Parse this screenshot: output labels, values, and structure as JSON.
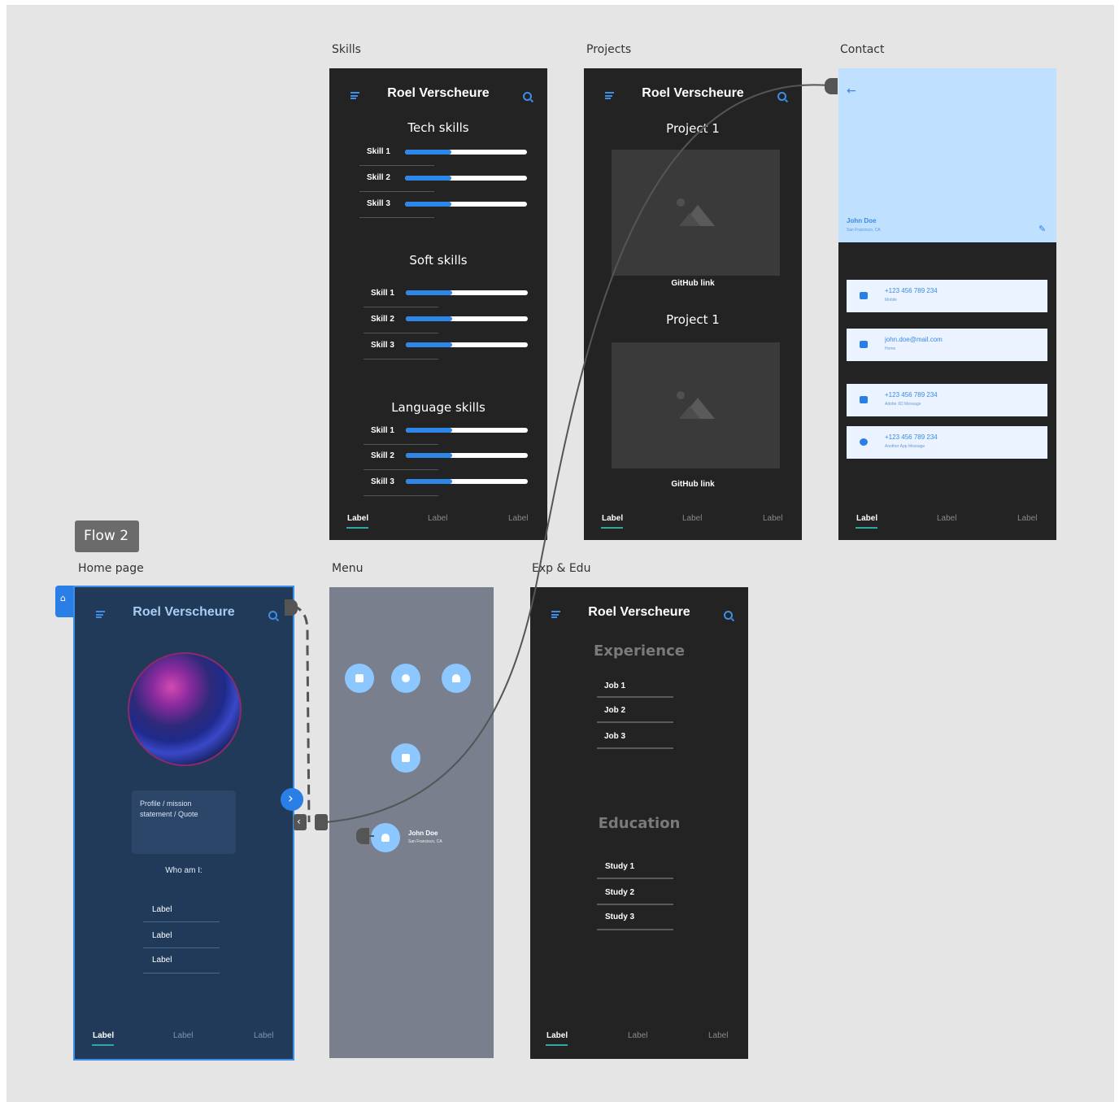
{
  "flow": {
    "label": "Flow 2"
  },
  "artboards": {
    "skills": "Skills",
    "projects": "Projects",
    "contact": "Contact",
    "home": "Home page",
    "menu": "Menu",
    "exp": "Exp & Edu"
  },
  "app": {
    "title": "Roel Verscheure"
  },
  "tabs": [
    "Label",
    "Label",
    "Label"
  ],
  "skills": {
    "tech": {
      "title": "Tech skills",
      "items": [
        {
          "label": "Skill 1",
          "level": 0.38
        },
        {
          "label": "Skill 2",
          "level": 0.38
        },
        {
          "label": "Skill 3",
          "level": 0.38
        }
      ]
    },
    "soft": {
      "title": "Soft skills",
      "items": [
        {
          "label": "Skill 1",
          "level": 0.38
        },
        {
          "label": "Skill 2",
          "level": 0.38
        },
        {
          "label": "Skill 3",
          "level": 0.38
        }
      ]
    },
    "language": {
      "title": "Language skills",
      "items": [
        {
          "label": "Skill 1",
          "level": 0.38
        },
        {
          "label": "Skill 2",
          "level": 0.38
        },
        {
          "label": "Skill 3",
          "level": 0.38
        }
      ]
    }
  },
  "projects": [
    {
      "title": "Project 1",
      "link": "GitHub link"
    },
    {
      "title": "Project 1",
      "link": "GitHub link"
    }
  ],
  "contact": {
    "name": "John Doe",
    "location": "San Francisco, CA",
    "cards": [
      {
        "value": "+123 456 789 234",
        "sub": "Mobile",
        "icon": "phone-icon"
      },
      {
        "value": "john.doe@mail.com",
        "sub": "Home",
        "icon": "mail-icon"
      },
      {
        "value": "+123 456 789 234",
        "sub": "Adobe XD Message",
        "icon": "chat-icon"
      },
      {
        "value": "+123 456 789 234",
        "sub": "Another App Message",
        "icon": "message-icon"
      }
    ]
  },
  "home": {
    "profile_text": "Profile / mission statement / Quote",
    "who": "Who am I:",
    "labels": [
      "Label",
      "Label",
      "Label"
    ]
  },
  "menu": {
    "user_name": "John Doe",
    "user_location": "San Francisco, CA",
    "icons": [
      "list-icon",
      "compass-icon",
      "bell-icon",
      "mail-icon"
    ]
  },
  "exp": {
    "experience_title": "Experience",
    "jobs": [
      "Job 1",
      "Job 2",
      "Job 3"
    ],
    "education_title": "Education",
    "studies": [
      "Study 1",
      "Study 2",
      "Study 3"
    ]
  },
  "colors": {
    "canvas": "#e5e5e5",
    "dark": "#232323",
    "home_bg": "#213a5a",
    "menu_bg": "#7a7f8e",
    "contact_header": "#bfe0ff",
    "accent": "#2e86e8"
  }
}
